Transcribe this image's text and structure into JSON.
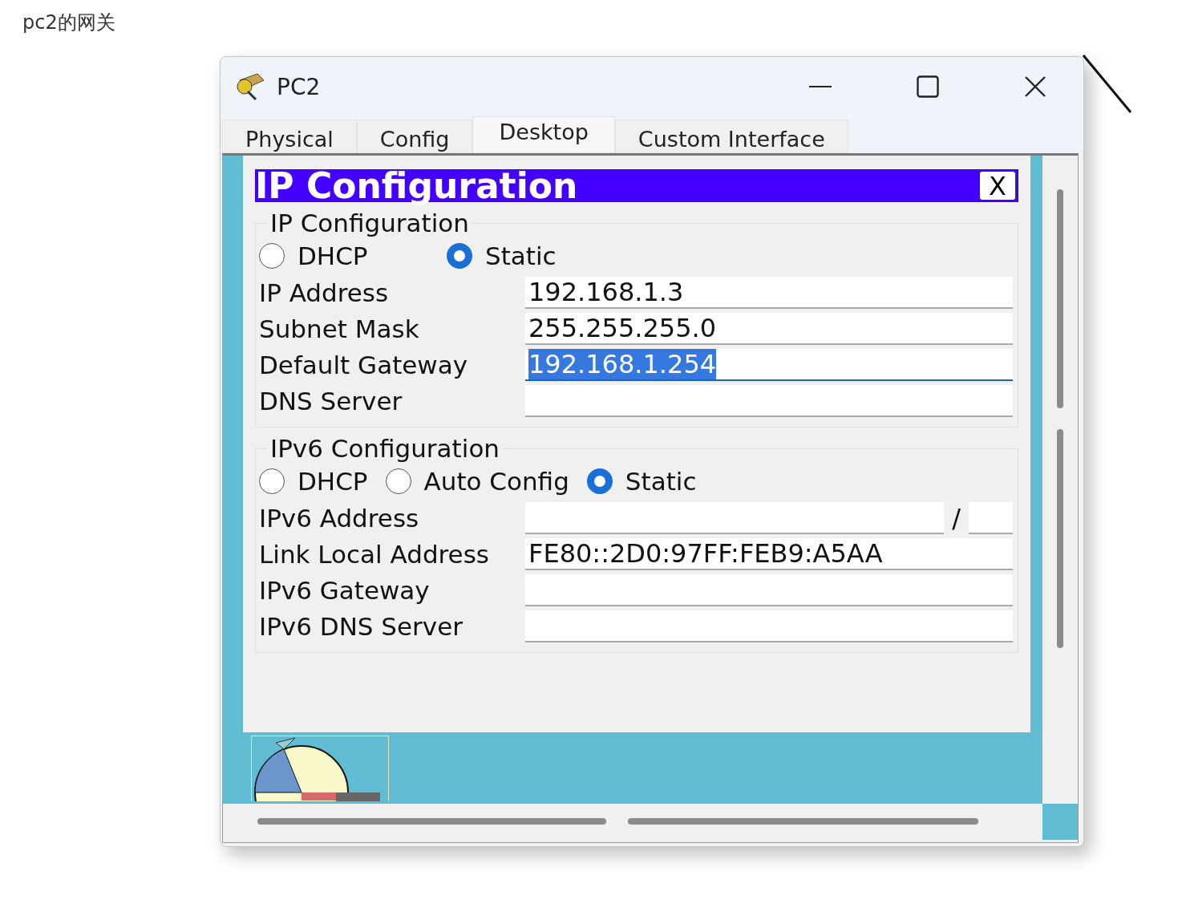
{
  "caption": "pc2的网关",
  "window": {
    "title": "PC2"
  },
  "tabs": [
    {
      "label": "Physical",
      "selected": false
    },
    {
      "label": "Config",
      "selected": false
    },
    {
      "label": "Desktop",
      "selected": true
    },
    {
      "label": "Custom Interface",
      "selected": false
    }
  ],
  "dialog": {
    "title": "IP Configuration",
    "close": "X",
    "ipv4": {
      "legend": "IP Configuration",
      "modes": [
        {
          "label": "DHCP",
          "selected": false
        },
        {
          "label": "Static",
          "selected": true
        }
      ],
      "fields": [
        {
          "label": "IP Address",
          "value": "192.168.1.3",
          "focused": false
        },
        {
          "label": "Subnet Mask",
          "value": "255.255.255.0",
          "focused": false
        },
        {
          "label": "Default Gateway",
          "value": "192.168.1.254",
          "focused": true
        },
        {
          "label": "DNS Server",
          "focused": false
        }
      ]
    },
    "ipv6": {
      "legend": "IPv6 Configuration",
      "modes": [
        {
          "label": "DHCP",
          "selected": false
        },
        {
          "label": "Auto Config",
          "selected": false
        },
        {
          "label": "Static",
          "selected": true
        }
      ],
      "fields": [
        {
          "label": "IPv6 Address",
          "kind": "prefix",
          "separator": "/",
          "focused": false
        },
        {
          "label": "Link Local Address",
          "value": "FE80::2D0:97FF:FEB9:A5AA",
          "focused": false
        },
        {
          "label": "IPv6 Gateway",
          "focused": false
        },
        {
          "label": "IPv6 DNS Server",
          "focused": false
        }
      ]
    }
  }
}
